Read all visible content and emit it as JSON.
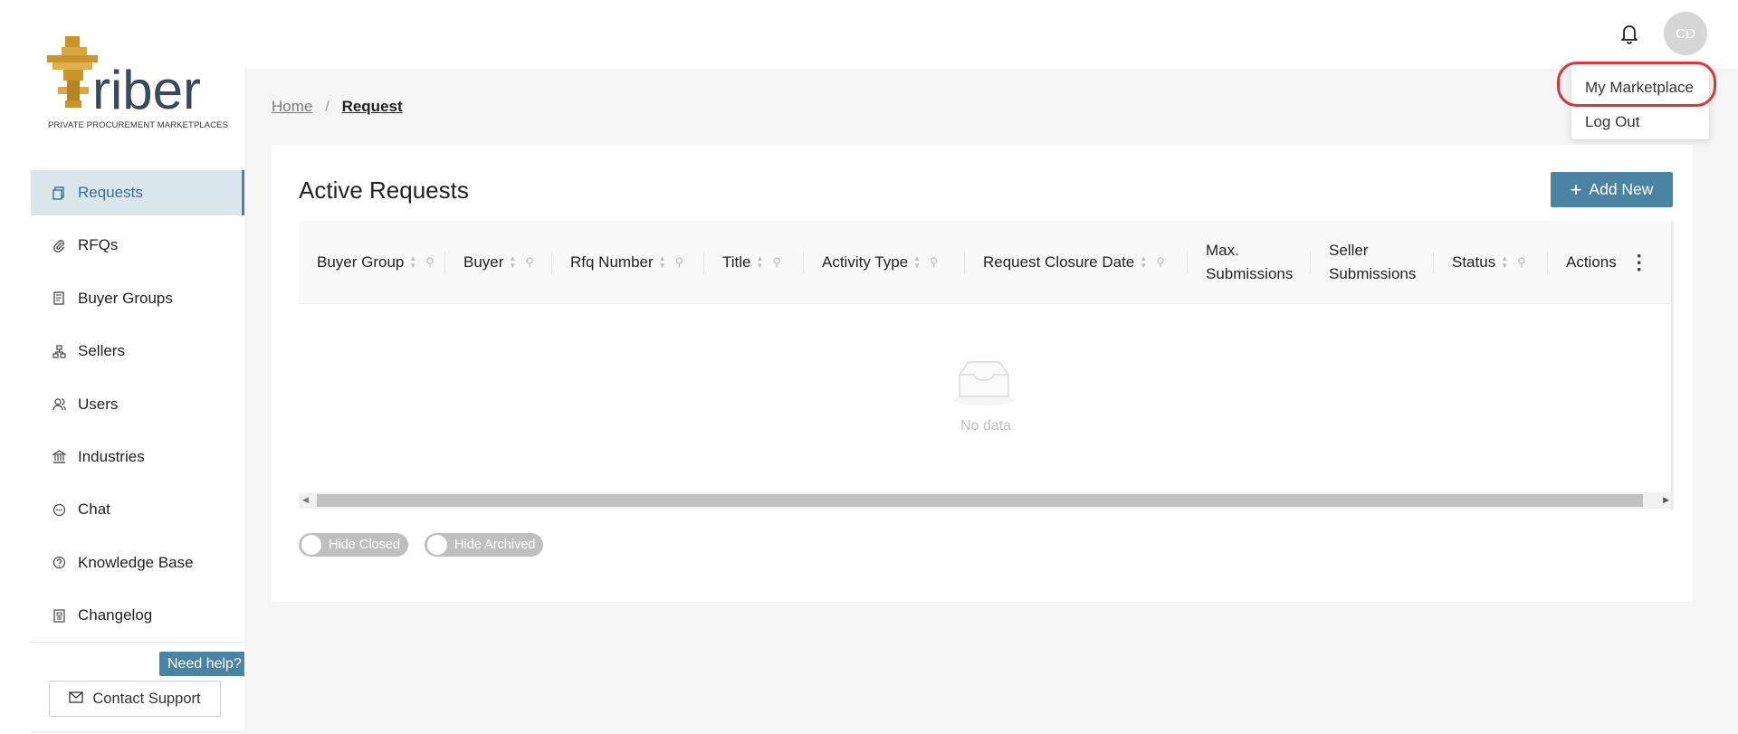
{
  "header": {
    "avatar_initials": "CD",
    "user_menu": {
      "items": [
        {
          "label": "My Marketplace"
        },
        {
          "label": "Log Out"
        }
      ]
    }
  },
  "brand": {
    "logo_word": "riber",
    "tagline": "PRIVATE PROCUREMENT MARKETPLACES",
    "accent_color": "#4a84a2",
    "logo_gold": "#c8952a"
  },
  "sidebar": {
    "items": [
      {
        "label": "Requests",
        "icon": "document-copy-icon",
        "active": true
      },
      {
        "label": "RFQs",
        "icon": "paperclip-icon"
      },
      {
        "label": "Buyer Groups",
        "icon": "receipt-icon"
      },
      {
        "label": "Sellers",
        "icon": "org-chart-icon"
      },
      {
        "label": "Users",
        "icon": "users-icon"
      },
      {
        "label": "Industries",
        "icon": "bank-icon"
      },
      {
        "label": "Chat",
        "icon": "chat-bubble-icon"
      },
      {
        "label": "Knowledge Base",
        "icon": "question-circle-icon"
      },
      {
        "label": "Changelog",
        "icon": "file-list-icon"
      }
    ],
    "need_help": "Need help?",
    "contact_support": "Contact Support"
  },
  "breadcrumb": {
    "home": "Home",
    "separator": "/",
    "current": "Request"
  },
  "requests": {
    "title": "Active Requests",
    "add_new": "Add New",
    "columns": [
      {
        "label": "Buyer Group"
      },
      {
        "label": "Buyer"
      },
      {
        "label": "Rfq Number"
      },
      {
        "label": "Title"
      },
      {
        "label": "Activity Type"
      },
      {
        "label": "Request Closure Date"
      },
      {
        "label": "Max. Submissions"
      },
      {
        "label": "Seller Submissions"
      },
      {
        "label": "Status"
      },
      {
        "label": "Actions"
      }
    ],
    "empty_text": "No data",
    "toggles": [
      {
        "label": "Hide Closed",
        "on": false
      },
      {
        "label": "Hide Archived",
        "on": false
      }
    ]
  }
}
